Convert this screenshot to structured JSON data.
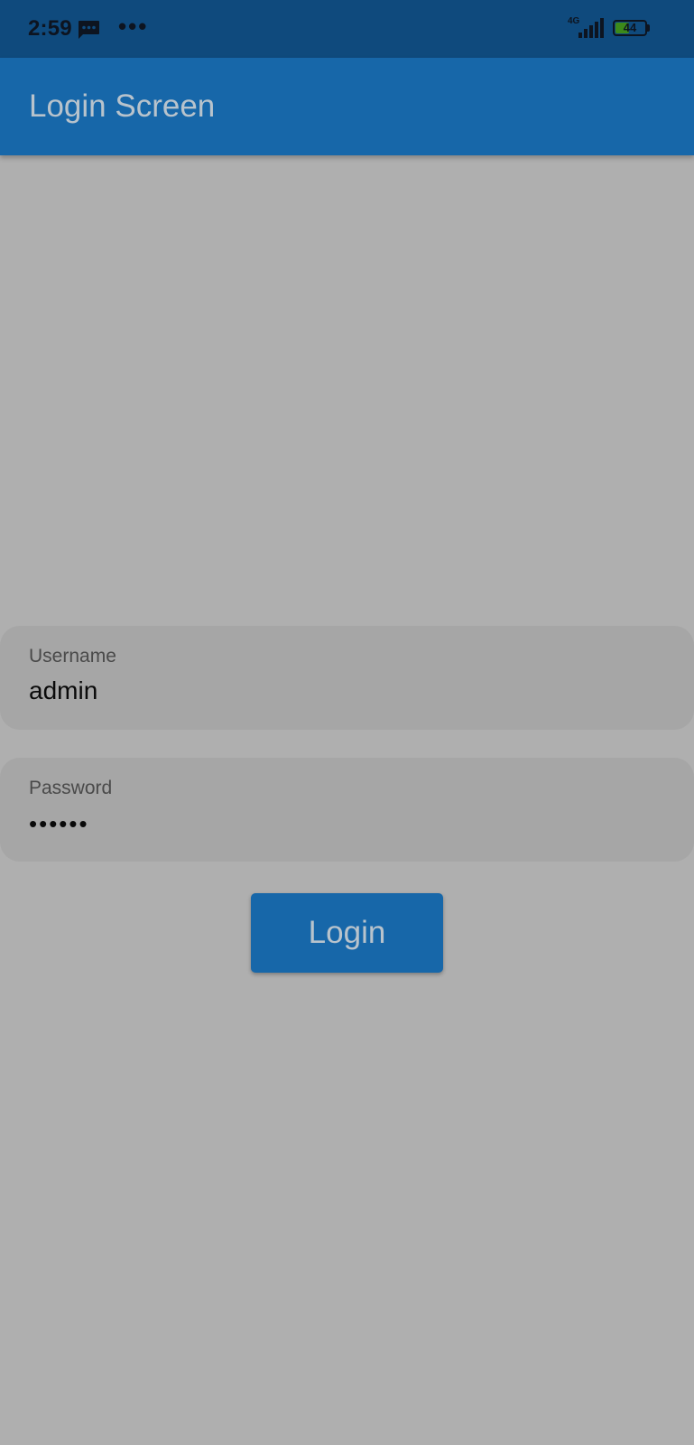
{
  "status_bar": {
    "time": "2:59",
    "more_indicator": "•••",
    "network_type": "4G",
    "battery_level": "44",
    "icons": [
      "message-icon",
      "signal-icon",
      "battery-icon"
    ]
  },
  "app_bar": {
    "title": "Login Screen"
  },
  "form": {
    "username": {
      "label": "Username",
      "value": "admin"
    },
    "password": {
      "label": "Password",
      "value": "••••••"
    },
    "login_label": "Login"
  },
  "colors": {
    "background": "#afafaf",
    "app_bar": "#1767a9",
    "status_bar": "#0f4a7d",
    "field_fill": "#a6a6a6",
    "battery_fill": "#3c8a1a"
  }
}
